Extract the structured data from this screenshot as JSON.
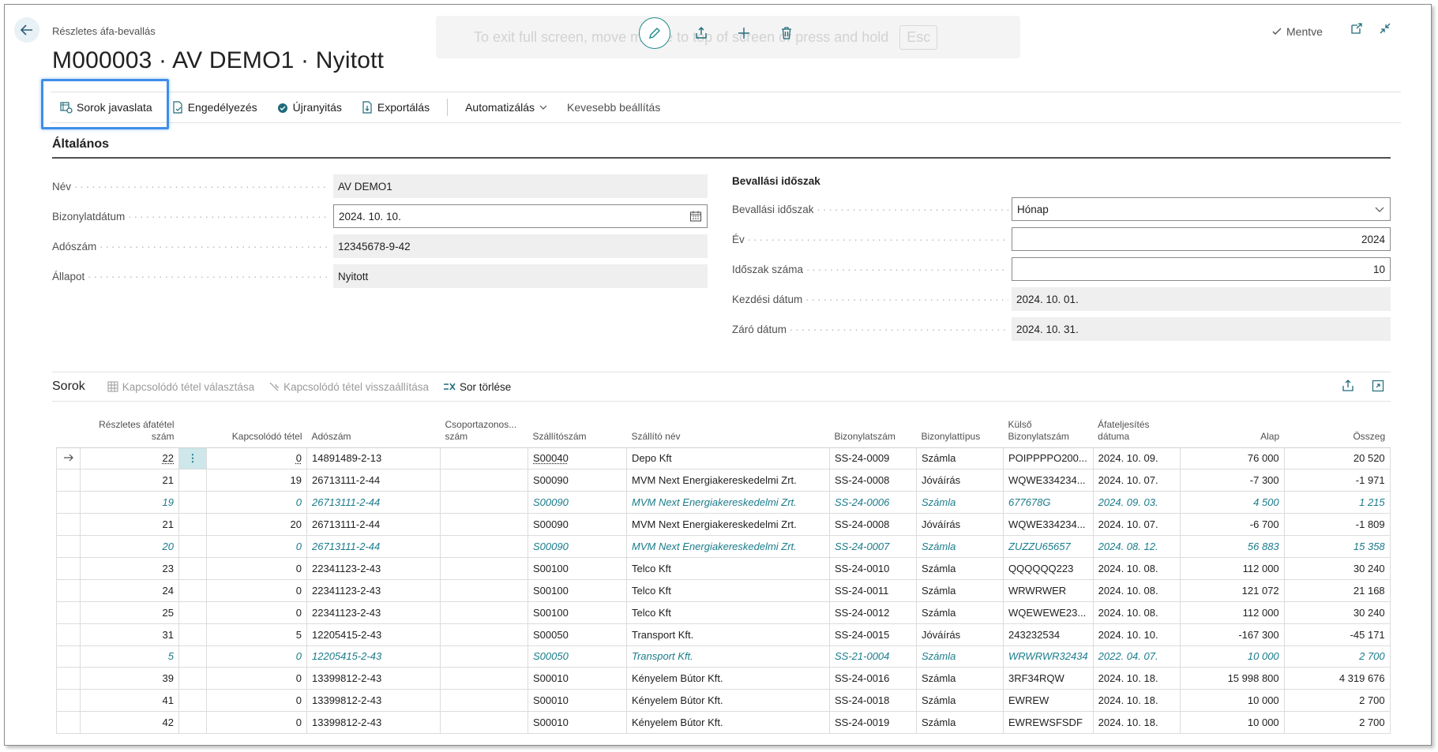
{
  "header": {
    "breadcrumb": "Részletes áfa-bevallás",
    "title": "M000003 · AV DEMO1 · Nyitott",
    "saved_label": "Mentve",
    "fullscreen_hint": "To exit full screen, move mouse to top of screen or press and hold",
    "fullscreen_key": "Esc"
  },
  "actions": {
    "suggest_lines": "Sorok javaslata",
    "release": "Engedélyezés",
    "reopen": "Újranyitás",
    "export": "Exportálás",
    "automate": "Automatizálás",
    "fewer_options": "Kevesebb beállítás"
  },
  "general": {
    "section_title": "Általános",
    "name_label": "Név",
    "name_value": "AV DEMO1",
    "doc_date_label": "Bizonylatdátum",
    "doc_date_value": "2024. 10. 10.",
    "tax_no_label": "Adószám",
    "tax_no_value": "12345678-9-42",
    "status_label": "Állapot",
    "status_value": "Nyitott",
    "period_heading": "Bevallási időszak",
    "period_label": "Bevallási időszak",
    "period_value": "Hónap",
    "year_label": "Év",
    "year_value": "2024",
    "period_no_label": "Időszak száma",
    "period_no_value": "10",
    "start_label": "Kezdési dátum",
    "start_value": "2024. 10. 01.",
    "end_label": "Záró dátum",
    "end_value": "2024. 10. 31."
  },
  "lines": {
    "title": "Sorok",
    "select_related": "Kapcsolódó tétel választása",
    "reset_related": "Kapcsolódó tétel visszaállítása",
    "delete_line": "Sor törlése",
    "columns": {
      "detail_no": "Részletes áfatétel szám",
      "related": "Kapcsolódó tétel",
      "tax_no": "Adószám",
      "group_tax_no": "Csoportazonos... szám",
      "vendor_no": "Szállítószám",
      "vendor_name": "Szállító név",
      "doc_no": "Bizonylatszám",
      "doc_type": "Bizonylattípus",
      "ext_doc_no": "Külső Bizonylatszám",
      "vat_date": "Áfateljesítés dátuma",
      "base": "Alap",
      "amount": "Összeg"
    },
    "rows": [
      {
        "detail_no": "22",
        "related": "0",
        "tax_no": "14891489-2-13",
        "group": "",
        "vendor_no": "S00040",
        "vendor_name": "Depo Kft",
        "doc_no": "SS-24-0009",
        "doc_type": "Számla",
        "ext_doc": "POIPPPPO200...",
        "vat_date": "2024. 10. 09.",
        "base": "76 000",
        "amount": "20 520"
      },
      {
        "detail_no": "21",
        "related": "19",
        "tax_no": "26713111-2-44",
        "group": "",
        "vendor_no": "S00090",
        "vendor_name": "MVM Next Energiakereskedelmi Zrt.",
        "doc_no": "SS-24-0008",
        "doc_type": "Jóváírás",
        "ext_doc": "WQWE334234...",
        "vat_date": "2024. 10. 07.",
        "base": "-7 300",
        "amount": "-1 971"
      },
      {
        "detail_no": "19",
        "related": "0",
        "tax_no": "26713111-2-44",
        "group": "",
        "vendor_no": "S00090",
        "vendor_name": "MVM Next Energiakereskedelmi Zrt.",
        "doc_no": "SS-24-0006",
        "doc_type": "Számla",
        "ext_doc": "677678G",
        "vat_date": "2024. 09. 03.",
        "base": "4 500",
        "amount": "1 215"
      },
      {
        "detail_no": "21",
        "related": "20",
        "tax_no": "26713111-2-44",
        "group": "",
        "vendor_no": "S00090",
        "vendor_name": "MVM Next Energiakereskedelmi Zrt.",
        "doc_no": "SS-24-0008",
        "doc_type": "Jóváírás",
        "ext_doc": "WQWE334234...",
        "vat_date": "2024. 10. 07.",
        "base": "-6 700",
        "amount": "-1 809"
      },
      {
        "detail_no": "20",
        "related": "0",
        "tax_no": "26713111-2-44",
        "group": "",
        "vendor_no": "S00090",
        "vendor_name": "MVM Next Energiakereskedelmi Zrt.",
        "doc_no": "SS-24-0007",
        "doc_type": "Számla",
        "ext_doc": "ZUZZU65657",
        "vat_date": "2024. 08. 12.",
        "base": "56 883",
        "amount": "15 358"
      },
      {
        "detail_no": "23",
        "related": "0",
        "tax_no": "22341123-2-43",
        "group": "",
        "vendor_no": "S00100",
        "vendor_name": "Telco Kft",
        "doc_no": "SS-24-0010",
        "doc_type": "Számla",
        "ext_doc": "QQQQQQ223",
        "vat_date": "2024. 10. 08.",
        "base": "112 000",
        "amount": "30 240"
      },
      {
        "detail_no": "24",
        "related": "0",
        "tax_no": "22341123-2-43",
        "group": "",
        "vendor_no": "S00100",
        "vendor_name": "Telco Kft",
        "doc_no": "SS-24-0011",
        "doc_type": "Számla",
        "ext_doc": "WRWRWER",
        "vat_date": "2024. 10. 08.",
        "base": "121 072",
        "amount": "21 168"
      },
      {
        "detail_no": "25",
        "related": "0",
        "tax_no": "22341123-2-43",
        "group": "",
        "vendor_no": "S00100",
        "vendor_name": "Telco Kft",
        "doc_no": "SS-24-0012",
        "doc_type": "Számla",
        "ext_doc": "WQEWEWE23...",
        "vat_date": "2024. 10. 08.",
        "base": "112 000",
        "amount": "30 240"
      },
      {
        "detail_no": "31",
        "related": "5",
        "tax_no": "12205415-2-43",
        "group": "",
        "vendor_no": "S00050",
        "vendor_name": "Transport Kft.",
        "doc_no": "SS-24-0015",
        "doc_type": "Jóváírás",
        "ext_doc": "243232534",
        "vat_date": "2024. 10. 10.",
        "base": "-167 300",
        "amount": "-45 171"
      },
      {
        "detail_no": "5",
        "related": "0",
        "tax_no": "12205415-2-43",
        "group": "",
        "vendor_no": "S00050",
        "vendor_name": "Transport Kft.",
        "doc_no": "SS-21-0004",
        "doc_type": "Számla",
        "ext_doc": "WRWRWR32434",
        "vat_date": "2022. 04. 07.",
        "base": "10 000",
        "amount": "2 700"
      },
      {
        "detail_no": "39",
        "related": "0",
        "tax_no": "13399812-2-43",
        "group": "",
        "vendor_no": "S00010",
        "vendor_name": "Kényelem Bútor Kft.",
        "doc_no": "SS-24-0016",
        "doc_type": "Számla",
        "ext_doc": "3RF34RQW",
        "vat_date": "2024. 10. 18.",
        "base": "15 998 800",
        "amount": "4 319 676"
      },
      {
        "detail_no": "41",
        "related": "0",
        "tax_no": "13399812-2-43",
        "group": "",
        "vendor_no": "S00010",
        "vendor_name": "Kényelem Bútor Kft.",
        "doc_no": "SS-24-0018",
        "doc_type": "Számla",
        "ext_doc": "EWREW",
        "vat_date": "2024. 10. 18.",
        "base": "10 000",
        "amount": "2 700"
      },
      {
        "detail_no": "42",
        "related": "0",
        "tax_no": "13399812-2-43",
        "group": "",
        "vendor_no": "S00010",
        "vendor_name": "Kényelem Bútor Kft.",
        "doc_no": "SS-24-0019",
        "doc_type": "Számla",
        "ext_doc": "EWREWSFSDF",
        "vat_date": "2024. 10. 18.",
        "base": "10 000",
        "amount": "2 700"
      }
    ],
    "italic_rows": [
      2,
      4,
      9
    ],
    "selected_row": 0
  },
  "colors": {
    "accent": "#1f8b8b",
    "highlight": "#3e8ee8",
    "linked_row": "#1a7c8b"
  }
}
